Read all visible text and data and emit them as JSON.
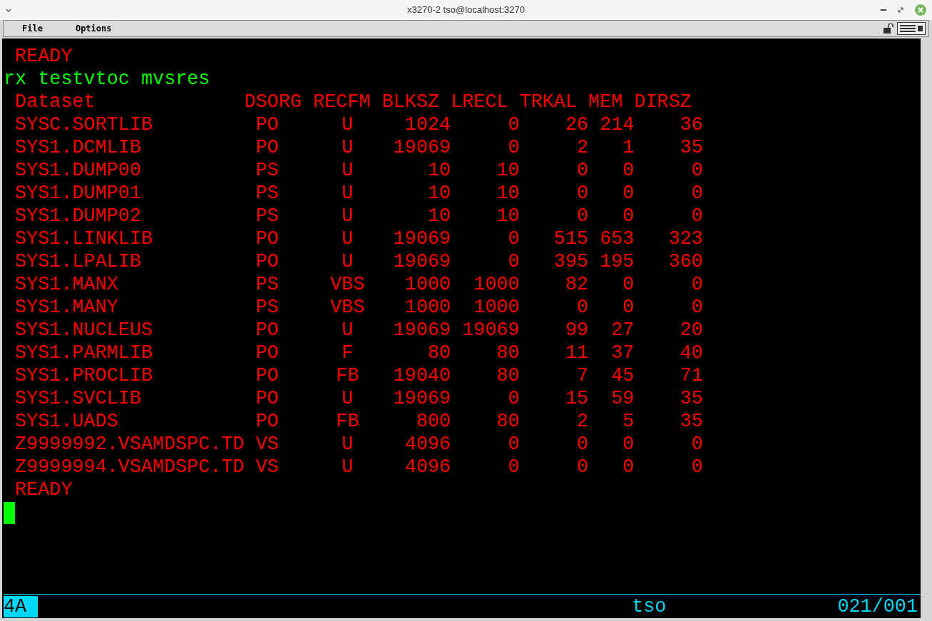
{
  "window": {
    "title": "x3270-2 tso@localhost:3270"
  },
  "menu": [
    "File",
    "Options"
  ],
  "lines_before": [
    {
      "kind": "output",
      "text": "READY"
    },
    {
      "kind": "input",
      "text": "rx testvtoc mvsres"
    }
  ],
  "table": {
    "columns": [
      "Dataset",
      "DSORG",
      "RECFM",
      "BLKSZ",
      "LRECL",
      "TRKAL",
      "MEM",
      "DIRSZ"
    ],
    "rows": [
      [
        "SYSC.SORTLIB",
        "PO",
        "U",
        "1024",
        "0",
        "26",
        "214",
        "36"
      ],
      [
        "SYS1.DCMLIB",
        "PO",
        "U",
        "19069",
        "0",
        "2",
        "1",
        "35"
      ],
      [
        "SYS1.DUMP00",
        "PS",
        "U",
        "10",
        "10",
        "0",
        "0",
        "0"
      ],
      [
        "SYS1.DUMP01",
        "PS",
        "U",
        "10",
        "10",
        "0",
        "0",
        "0"
      ],
      [
        "SYS1.DUMP02",
        "PS",
        "U",
        "10",
        "10",
        "0",
        "0",
        "0"
      ],
      [
        "SYS1.LINKLIB",
        "PO",
        "U",
        "19069",
        "0",
        "515",
        "653",
        "323"
      ],
      [
        "SYS1.LPALIB",
        "PO",
        "U",
        "19069",
        "0",
        "395",
        "195",
        "360"
      ],
      [
        "SYS1.MANX",
        "PS",
        "VBS",
        "1000",
        "1000",
        "82",
        "0",
        "0"
      ],
      [
        "SYS1.MANY",
        "PS",
        "VBS",
        "1000",
        "1000",
        "0",
        "0",
        "0"
      ],
      [
        "SYS1.NUCLEUS",
        "PO",
        "U",
        "19069",
        "19069",
        "99",
        "27",
        "20"
      ],
      [
        "SYS1.PARMLIB",
        "PO",
        "F",
        "80",
        "80",
        "11",
        "37",
        "40"
      ],
      [
        "SYS1.PROCLIB",
        "PO",
        "FB",
        "19040",
        "80",
        "7",
        "45",
        "71"
      ],
      [
        "SYS1.SVCLIB",
        "PO",
        "U",
        "19069",
        "0",
        "15",
        "59",
        "35"
      ],
      [
        "SYS1.UADS",
        "PO",
        "FB",
        "800",
        "80",
        "2",
        "5",
        "35"
      ],
      [
        "Z9999992.VSAMDSPC.TD",
        "VS",
        "U",
        "4096",
        "0",
        "0",
        "0",
        "0"
      ],
      [
        "Z9999994.VSAMDSPC.TD",
        "VS",
        "U",
        "4096",
        "0",
        "0",
        "0",
        "0"
      ]
    ]
  },
  "lines_after": [
    {
      "kind": "output",
      "text": "READY"
    }
  ],
  "status_bar": {
    "mode": "4A",
    "user": "tso",
    "cursor_position": "021/001"
  }
}
